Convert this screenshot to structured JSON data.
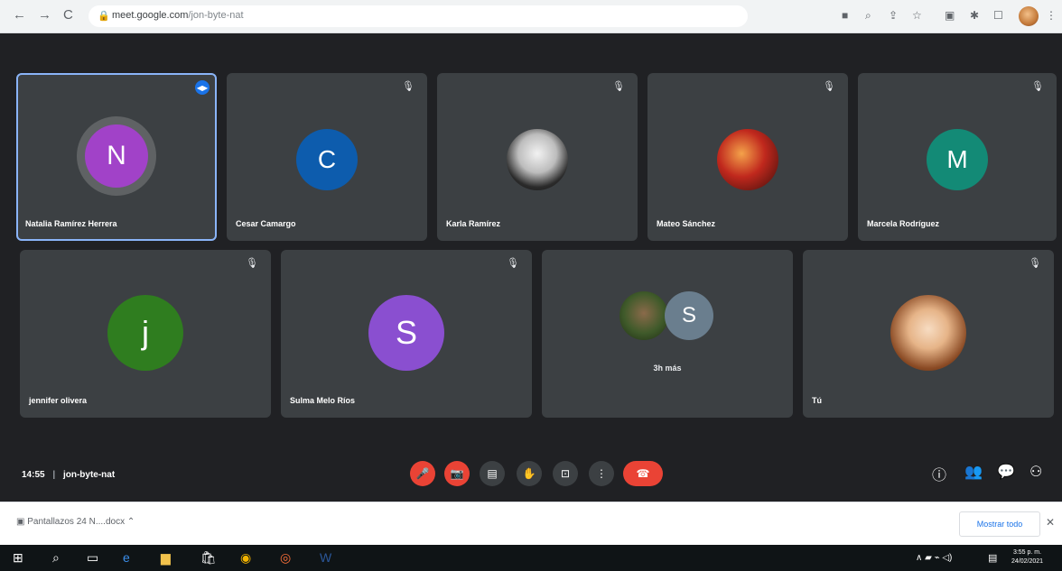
{
  "browser": {
    "url_host": "meet.google.com",
    "url_path": "/jon-byte-nat"
  },
  "tiles": [
    {
      "initial": "N",
      "name": "Natalia Ramírez Herrera",
      "avatar_color": "#a142c8"
    },
    {
      "initial": "C",
      "name": "Cesar Camargo",
      "avatar_color": "#0d5cad"
    },
    {
      "initial": "",
      "name": "Karla Ramírez",
      "avatar_color": "#d8d8d8"
    },
    {
      "initial": "",
      "name": "Mateo Sánchez",
      "avatar_color": "#c0281d"
    },
    {
      "initial": "M",
      "name": "Marcela Rodríguez",
      "avatar_color": "#138a76"
    },
    {
      "initial": "j",
      "name": "jennifer olivera",
      "avatar_color": "#2f7d1f"
    },
    {
      "initial": "S",
      "name": "Sulma Melo Ríos",
      "avatar_color": "#8a4fd0"
    },
    {
      "initial": "S",
      "name": "",
      "avatar_color": "#6a7e8e",
      "more_label": "3h más"
    },
    {
      "initial": "",
      "name": "Tú",
      "avatar_color": "#e6b488"
    }
  ],
  "meeting": {
    "time": "14:55",
    "separator": "|",
    "code": "jon-byte-nat"
  },
  "download": {
    "file": "Pantallazos 24 N....docx",
    "show_all": "Mostrar todo",
    "close": "✕"
  },
  "taskbar": {
    "time": "3:55 p. m.",
    "date": "24/02/2021"
  },
  "colors": {
    "meet_bg": "#202124",
    "tile_bg": "#3c4043",
    "active_outline": "#8ab4f8",
    "danger": "#ea4335"
  }
}
